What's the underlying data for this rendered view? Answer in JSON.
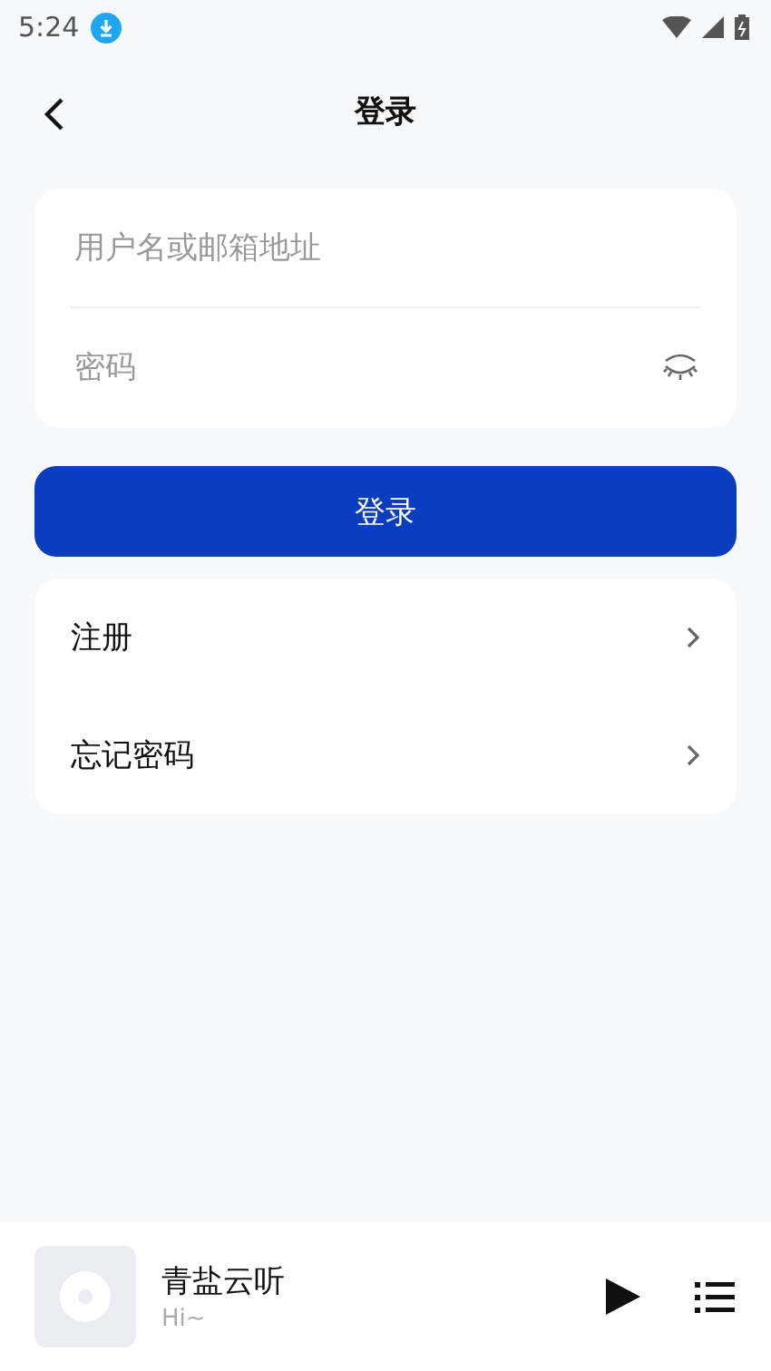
{
  "status_bar": {
    "time": "5:24"
  },
  "header": {
    "title": "登录"
  },
  "form": {
    "username": {
      "placeholder": "用户名或邮箱地址"
    },
    "password": {
      "placeholder": "密码",
      "visible": false
    }
  },
  "login_button": {
    "label": "登录"
  },
  "menu": [
    {
      "label": "注册"
    },
    {
      "label": "忘记密码"
    }
  ],
  "player": {
    "title": "青盐云听",
    "subtitle": "Hi~",
    "playing": false
  }
}
